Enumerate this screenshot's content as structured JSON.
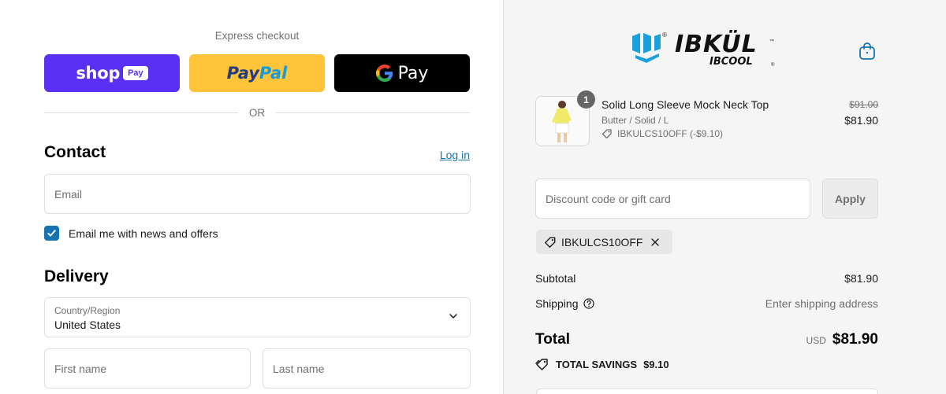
{
  "colors": {
    "accent": "#1773b0",
    "shop_pay": "#5a31f4",
    "paypal": "#ffc439",
    "gpay": "#000000",
    "brand_blue": "#1aa0dc"
  },
  "express": {
    "title": "Express checkout",
    "shop_word": "shop",
    "shop_pill": "Pay",
    "paypal_part1": "Pay",
    "paypal_part2": "Pal",
    "gpay_word": "Pay",
    "or": "OR"
  },
  "contact": {
    "heading": "Contact",
    "login": "Log in",
    "email_placeholder": "Email",
    "newsletter_label": "Email me with news and offers",
    "newsletter_checked": true
  },
  "delivery": {
    "heading": "Delivery",
    "country_label": "Country/Region",
    "country_value": "United States",
    "first_name_placeholder": "First name",
    "last_name_placeholder": "Last name"
  },
  "brand": {
    "name_main": "IBKÜL",
    "name_sub": "IBCOOL"
  },
  "cart": {
    "quantity": "1",
    "item_name": "Solid Long Sleeve Mock Neck Top",
    "item_variant": "Butter / Solid / L",
    "item_discount": "IBKULCS10OFF (-$9.10)",
    "price_old": "$91.00",
    "price_new": "$81.90"
  },
  "discount": {
    "placeholder": "Discount code or gift card",
    "apply_label": "Apply",
    "applied_code": "IBKULCS10OFF"
  },
  "summary": {
    "subtotal_label": "Subtotal",
    "subtotal_value": "$81.90",
    "shipping_label": "Shipping",
    "shipping_value": "Enter shipping address",
    "total_label": "Total",
    "total_currency": "USD",
    "total_value": "$81.90",
    "savings_label": "TOTAL SAVINGS",
    "savings_value": "$9.10"
  },
  "icons": [
    "shop-pay-logo",
    "paypal-logo",
    "google-g-icon",
    "checkmark-icon",
    "chevron-down-icon",
    "shopping-bag-icon",
    "tag-icon",
    "close-icon",
    "help-circle-icon",
    "brand-logo"
  ]
}
